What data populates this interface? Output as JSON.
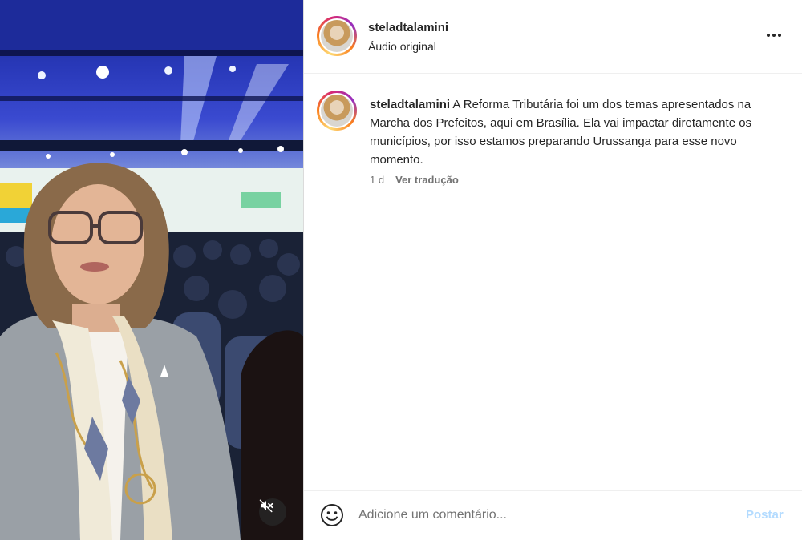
{
  "post": {
    "username": "steladtalamini",
    "audio_label": "Áudio original",
    "caption_text": " A Reforma Tributária foi um dos temas apresentados na Marcha dos Prefeitos, aqui em Brasília. Ela vai impactar diretamente os municípios, por isso estamos preparando Urussanga para esse novo momento.",
    "age": "1 d",
    "translate_label": "Ver tradução"
  },
  "comment": {
    "placeholder": "Adicione um comentário...",
    "post_label": "Postar"
  },
  "icons": {
    "more": "more-options-icon",
    "mute": "speaker-muted-icon",
    "emoji": "emoji-smile-icon"
  },
  "colors": {
    "post_button_disabled": "#b3dbff",
    "text_secondary": "#737373",
    "border": "#dbdbdb"
  }
}
